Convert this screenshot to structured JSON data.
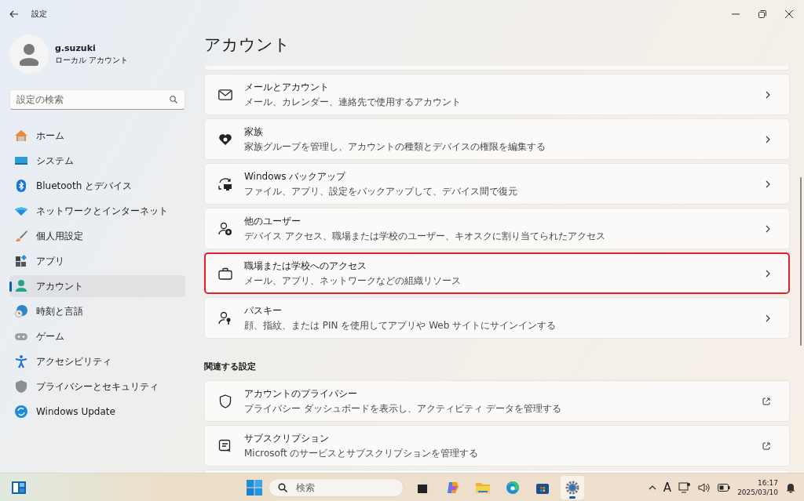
{
  "window": {
    "title": "設定"
  },
  "user": {
    "name": "g.suzuki",
    "account_type": "ローカル アカウント"
  },
  "search": {
    "placeholder": "設定の検索"
  },
  "nav": [
    {
      "label": "ホーム",
      "kind": "home",
      "selected": false
    },
    {
      "label": "システム",
      "kind": "system",
      "selected": false
    },
    {
      "label": "Bluetooth とデバイス",
      "kind": "bluetooth",
      "selected": false
    },
    {
      "label": "ネットワークとインターネット",
      "kind": "wifi",
      "selected": false
    },
    {
      "label": "個人用設定",
      "kind": "brush",
      "selected": false
    },
    {
      "label": "アプリ",
      "kind": "apps",
      "selected": false
    },
    {
      "label": "アカウント",
      "kind": "account",
      "selected": true
    },
    {
      "label": "時刻と言語",
      "kind": "globe",
      "selected": false
    },
    {
      "label": "ゲーム",
      "kind": "gamepad",
      "selected": false
    },
    {
      "label": "アクセシビリティ",
      "kind": "accessibility",
      "selected": false
    },
    {
      "label": "プライバシーとセキュリティ",
      "kind": "shield",
      "selected": false
    },
    {
      "label": "Windows Update",
      "kind": "update",
      "selected": false
    }
  ],
  "page_title": "アカウント",
  "cards": [
    {
      "title": "メールとアカウント",
      "description": "メール、カレンダー、連絡先で使用するアカウント",
      "kind": "nav",
      "highlighted": false
    },
    {
      "title": "家族",
      "description": "家族グループを管理し、アカウントの種類とデバイスの権限を編集する",
      "kind": "nav",
      "highlighted": false
    },
    {
      "title": "Windows バックアップ",
      "description": "ファイル、アプリ、設定をバックアップして、デバイス間で復元",
      "kind": "nav",
      "highlighted": false
    },
    {
      "title": "他のユーザー",
      "description": "デバイス アクセス、職場または学校のユーザー、キオスクに割り当てられたアクセス",
      "kind": "nav",
      "highlighted": false
    },
    {
      "title": "職場または学校へのアクセス",
      "description": "メール、アプリ、ネットワークなどの組織リソース",
      "kind": "nav",
      "highlighted": true
    },
    {
      "title": "パスキー",
      "description": "顔、指紋、または PIN を使用してアプリや Web サイトにサインインする",
      "kind": "nav",
      "highlighted": false
    }
  ],
  "related": {
    "heading": "関連する設定",
    "cards": [
      {
        "title": "アカウントのプライバシー",
        "description": "プライバシー ダッシュボードを表示し、アクティビティ データを管理する",
        "kind": "external",
        "highlighted": false
      },
      {
        "title": "サブスクリプション",
        "description": "Microsoft のサービスとサブスクリプションを管理する",
        "kind": "external",
        "highlighted": false
      }
    ]
  },
  "taskbar": {
    "search_placeholder": "検索",
    "apps": [
      {
        "kind": "task-view",
        "selected": false
      },
      {
        "kind": "copilot",
        "selected": false
      },
      {
        "kind": "folder",
        "selected": false
      },
      {
        "kind": "edge",
        "selected": false
      },
      {
        "kind": "store",
        "selected": false
      },
      {
        "kind": "settings",
        "selected": true
      }
    ],
    "ime": "A",
    "time": "16:17",
    "date": "2025/03/10"
  }
}
